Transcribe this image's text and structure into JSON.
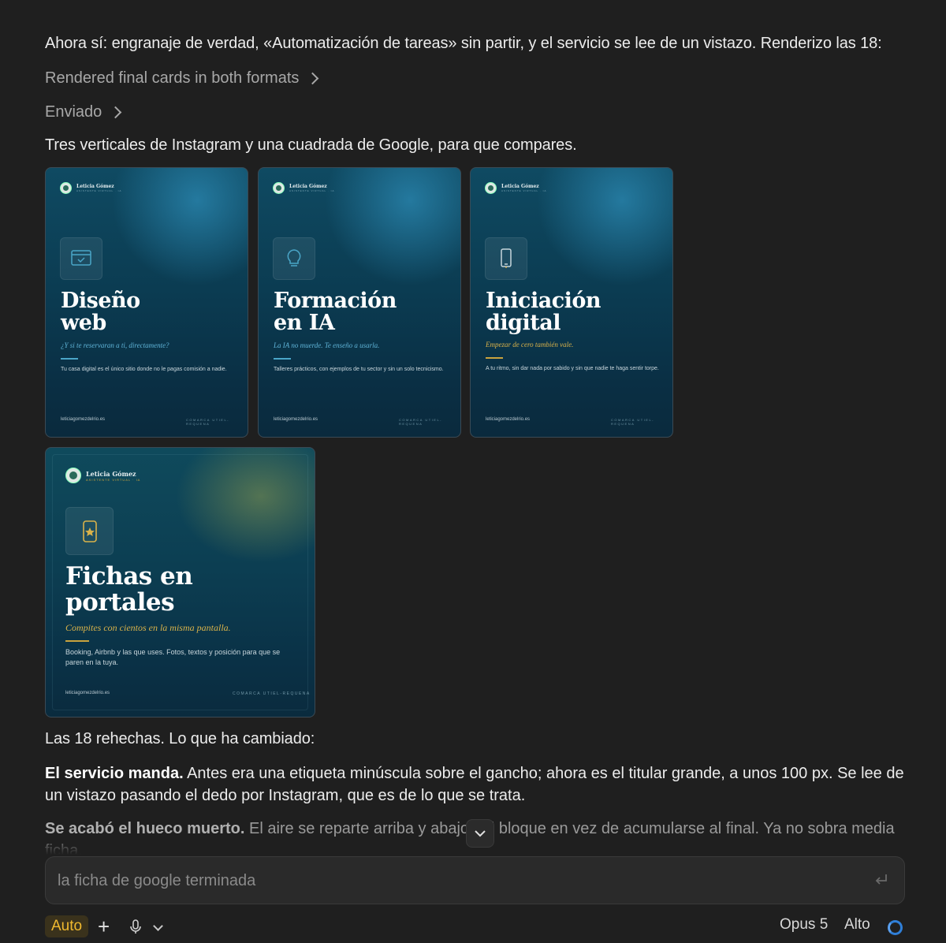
{
  "message": {
    "intro": "Ahora sí: engranaje de verdad, «Automatización de tareas» sin partir, y el servicio se lee de un vistazo. Renderizo las 18:",
    "steps": [
      {
        "label": "Rendered final cards in both formats"
      },
      {
        "label": "Enviado"
      }
    ],
    "caption": "Tres verticales de Instagram y una cuadrada de Google, para que compares.",
    "summary": "Las 18 rehechas. Lo que ha cambiado:",
    "point1_bold": "El servicio manda.",
    "point1_text": " Antes era una etiqueta minúscula sobre el gancho; ahora es el titular grande, a unos 100 px. Se lee de un vistazo pasando el dedo por Instagram, que es de lo que se trata.",
    "point2_bold": "Se acabó el hueco muerto.",
    "point2_text": " El aire se reparte arriba y abajo del bloque en vez de acumularse al final. Ya no sobra media ficha."
  },
  "cards": [
    {
      "brand": "Leticia Gómez",
      "brand_sub": "ASISTENTE VIRTUAL · IA",
      "icon": "browser-check-icon",
      "title_1": "Diseño",
      "title_2": "web",
      "subtitle": "¿Y si te reservaran a ti, directamente?",
      "body": "Tu casa digital es el único sitio donde no le pagas comisión a nadie.",
      "footer_left": "leticiagomezdelrio.es",
      "footer_right": "COMARCA UTIEL-REQUENA"
    },
    {
      "brand": "Leticia Gómez",
      "brand_sub": "ASISTENTE VIRTUAL · IA",
      "icon": "lightbulb-icon",
      "title_1": "Formación",
      "title_2": "en IA",
      "subtitle": "La IA no muerde. Te enseño a usarla.",
      "body": "Talleres prácticos, con ejemplos de tu sector y sin un solo tecnicismo.",
      "footer_left": "leticiagomezdelrio.es",
      "footer_right": "COMARCA UTIEL-REQUENA"
    },
    {
      "brand": "Leticia Gómez",
      "brand_sub": "ASISTENTE VIRTUAL · IA",
      "icon": "phone-icon",
      "title_1": "Iniciación",
      "title_2": "digital",
      "subtitle": "Empezar de cero también vale.",
      "body": "A tu ritmo, sin dar nada por sabido y sin que nadie te haga sentir torpe.",
      "footer_left": "leticiagomezdelrio.es",
      "footer_right": "COMARCA UTIEL-REQUENA"
    },
    {
      "brand": "Leticia Gómez",
      "brand_sub": "ASISTENTE VIRTUAL · IA",
      "icon": "phone-star-icon",
      "title_1": "Fichas en",
      "title_2": "portales",
      "subtitle": "Compites con cientos en la misma pantalla.",
      "body": "Booking, Airbnb y las que uses. Fotos, textos y posición para que se paren en la tuya.",
      "footer_left": "leticiagomezdelrio.es",
      "footer_right": "COMARCA UTIEL-REQUENA"
    }
  ],
  "composer": {
    "value": "la ficha de google terminada",
    "mode_badge": "Auto",
    "add_label": "+",
    "model": "Opus 5",
    "effort": "Alto"
  },
  "colors": {
    "accent_blue": "#4aa6c8",
    "accent_gold": "#d9b24a",
    "auto_badge": "#f0b92f",
    "spinner": "#2f7fd8"
  }
}
